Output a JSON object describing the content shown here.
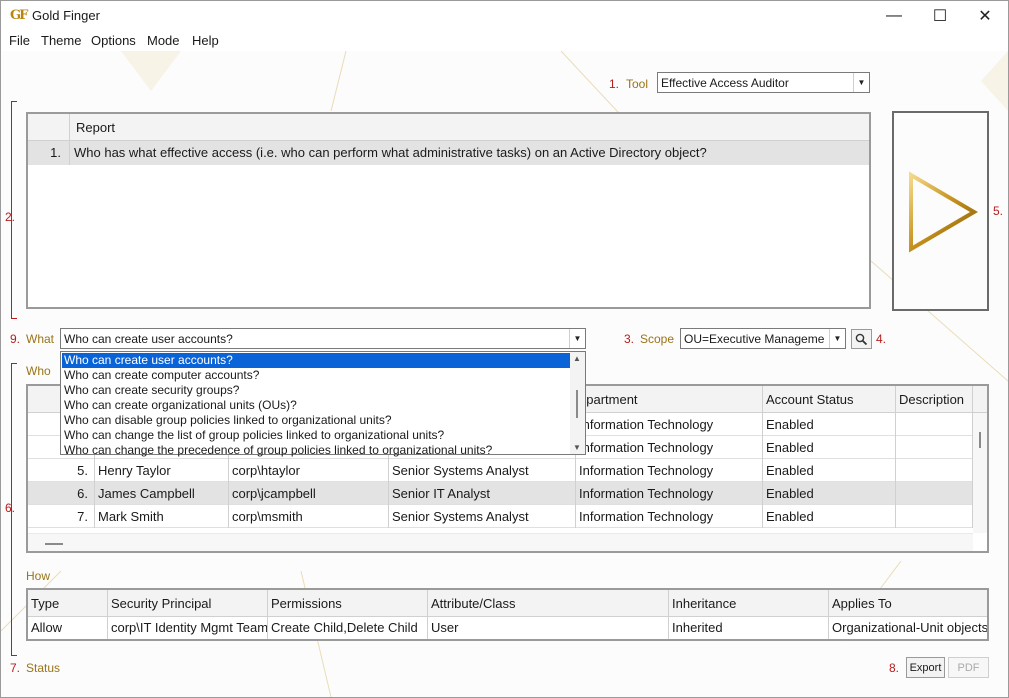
{
  "window": {
    "title": "Gold Finger",
    "logo_text": "GF",
    "controls": {
      "minimize": "—",
      "maximize": "☐",
      "close": "✕"
    }
  },
  "menu": [
    "File",
    "Theme",
    "Options",
    "Mode",
    "Help"
  ],
  "steps": {
    "tool": {
      "num": "1.",
      "label": "Tool",
      "value": "Effective Access Auditor"
    },
    "report_num": "2.",
    "scope": {
      "num": "3.",
      "label": "Scope",
      "value": "OU=Executive Manageme"
    },
    "search_num": "4.",
    "run_num": "5.",
    "who": {
      "num": "6.",
      "label": "Who"
    },
    "status": {
      "num": "7.",
      "label": "Status"
    },
    "export_num": "8.",
    "what": {
      "num": "9.",
      "label": "What",
      "value": "Who can create user accounts?"
    }
  },
  "report": {
    "header": "Report",
    "rows": [
      {
        "n": "1.",
        "text": "Who has what effective access (i.e. who can perform what administrative tasks) on an Active Directory object?"
      }
    ]
  },
  "what_options": [
    "Who can create user accounts?",
    "Who can create computer accounts?",
    "Who can create security groups?",
    "Who can create organizational units (OUs)?",
    "Who can disable group policies linked to organizational units?",
    "Who can change the list of group policies linked to organizational units?",
    "Who can change the precedence of group policies linked to organizational units?"
  ],
  "who": {
    "headers": [
      "",
      "",
      "",
      "",
      "Department",
      "Account Status",
      "Description"
    ],
    "header_visible": {
      "department": "epartment",
      "status": "Account Status",
      "description": "Description"
    },
    "rows": [
      {
        "n": "",
        "name": "",
        "login": "",
        "title": "",
        "dept": "Information Technology",
        "status": "Enabled"
      },
      {
        "n": "",
        "name": "",
        "login": "",
        "title": "",
        "dept": "Information Technology",
        "status": "Enabled"
      },
      {
        "n": "5.",
        "name": "Henry Taylor",
        "login": "corp\\htaylor",
        "title": "Senior Systems Analyst",
        "dept": "Information Technology",
        "status": "Enabled"
      },
      {
        "n": "6.",
        "name": "James Campbell",
        "login": "corp\\jcampbell",
        "title": "Senior IT Analyst",
        "dept": "Information Technology",
        "status": "Enabled"
      },
      {
        "n": "7.",
        "name": "Mark Smith",
        "login": "corp\\msmith",
        "title": "Senior Systems Analyst",
        "dept": "Information Technology",
        "status": "Enabled"
      }
    ],
    "selected_row": 3
  },
  "how": {
    "label": "How",
    "headers": [
      "Type",
      "Security Principal",
      "Permissions",
      "Attribute/Class",
      "Inheritance",
      "Applies To"
    ],
    "rows": [
      [
        "Allow",
        "corp\\IT Identity Mgmt Team",
        "Create Child,Delete Child",
        "User",
        "Inherited",
        "Organizational-Unit objects"
      ]
    ]
  },
  "buttons": {
    "export": "Export",
    "pdf": "PDF"
  },
  "colors": {
    "accent_gold": "#b8860b",
    "step_red": "#b81c1c",
    "label_gold": "#9a7417",
    "selection_blue": "#0a64d8"
  }
}
